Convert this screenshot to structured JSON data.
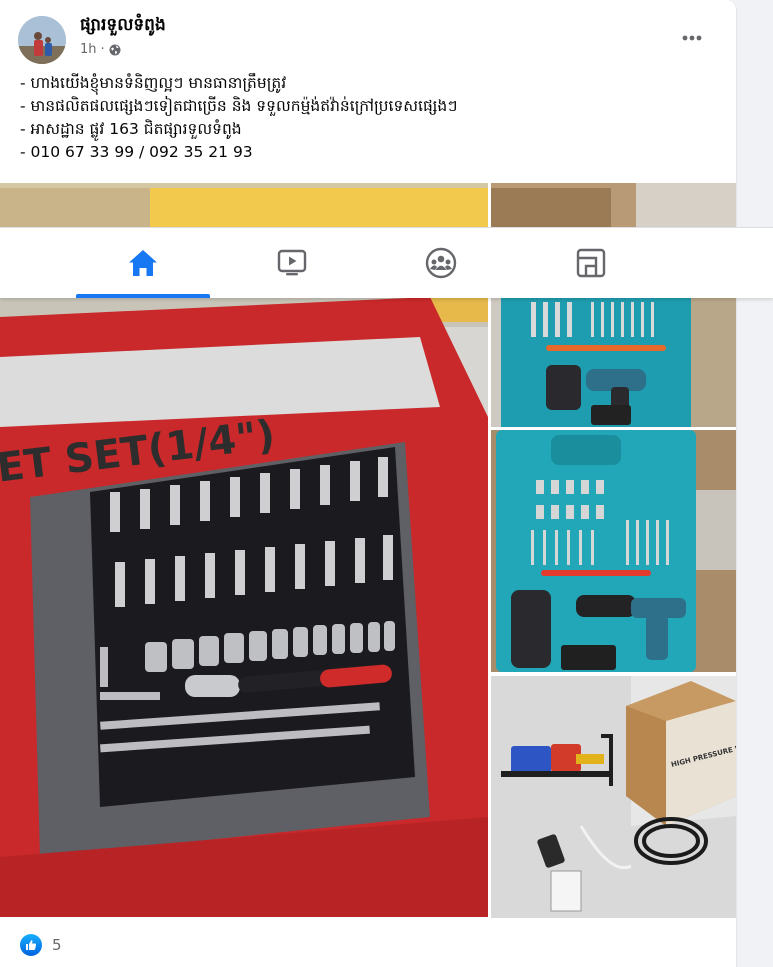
{
  "post": {
    "author": "ផ្សារទួលទំពូង",
    "time": "1h",
    "audience_icon": "globe-icon",
    "lines": [
      "- ហាងយើងខ្ញុំមានទំនិញល្អៗ មានធានាត្រឹមត្រូវ",
      "- មានផលិតផលផ្សេងៗទៀតជាច្រើន និង ទទួលកម៉្មង់ឥវ៉ាន់ក្រៅប្រទេសផ្សេងៗ",
      "- អាសដ្ឋាន ផ្លូវ 163 ជិតផ្សារទួលទំពូង",
      "- 010 67 33 99 / 092 35 21 93"
    ]
  },
  "images": {
    "main_box_text": "ET SET(1/4\")",
    "washer_box_text": "HIGH PRESSURE WASHER"
  },
  "nav": {
    "tabs": [
      {
        "name": "home",
        "icon": "home-icon",
        "active": true
      },
      {
        "name": "watch",
        "icon": "video-icon",
        "active": false
      },
      {
        "name": "groups",
        "icon": "groups-icon",
        "active": false
      },
      {
        "name": "gaming",
        "icon": "gaming-icon",
        "active": false
      }
    ]
  },
  "reactions": {
    "count": "5",
    "icon": "like-icon"
  },
  "colors": {
    "accent": "#1877f2",
    "secondary_text": "#65676b",
    "primary_text": "#050505"
  }
}
